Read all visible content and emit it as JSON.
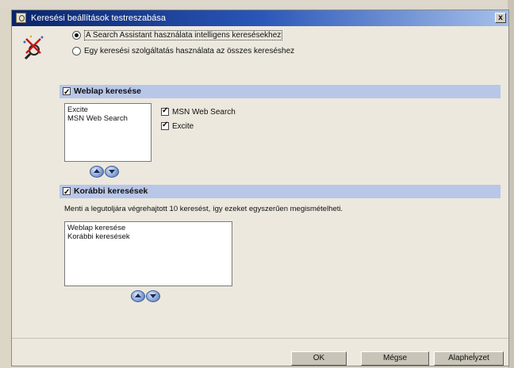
{
  "window": {
    "title": "Keresési beállítások testreszabása",
    "close_label": "x"
  },
  "mode": {
    "options": [
      {
        "label": "A Search Assistant használata intelligens keresésekhez",
        "checked": true
      },
      {
        "label": "Egy keresési szolgáltatás használata az összes kereséshez",
        "checked": false
      }
    ]
  },
  "web_search": {
    "header": "Weblap keresése",
    "checked": true,
    "list": [
      "Excite",
      "MSN Web Search"
    ],
    "engines": [
      {
        "label": "MSN Web Search",
        "checked": true
      },
      {
        "label": "Excite",
        "checked": true
      }
    ]
  },
  "history": {
    "header": "Korábbi keresések",
    "checked": true,
    "description": "Menti a legutoljára végrehajtott 10 keresést, így ezeket egyszerűen megismételheti.",
    "list": [
      "Weblap keresése",
      "Korábbi keresések"
    ]
  },
  "buttons": {
    "ok": "OK",
    "cancel": "Mégse",
    "default": "Alapheĺyzet"
  }
}
